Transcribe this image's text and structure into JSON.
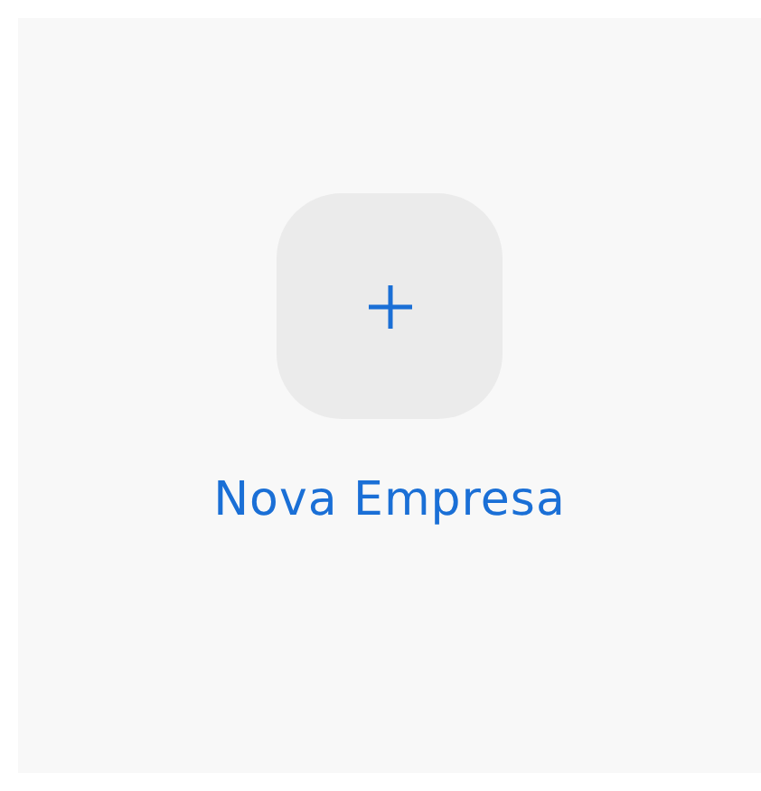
{
  "action": {
    "label": "Nova Empresa"
  }
}
